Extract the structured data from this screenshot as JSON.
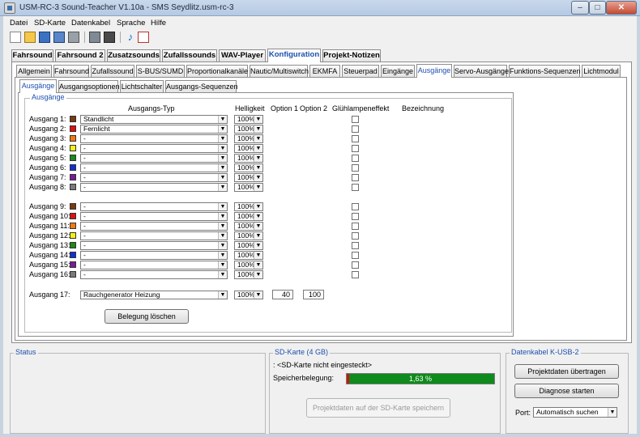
{
  "window": {
    "title": "USM-RC-3 Sound-Teacher V1.10a - SMS Seydlitz.usm-rc-3",
    "min": "–",
    "max": "□",
    "close": "✕"
  },
  "menu": [
    "Datei",
    "SD-Karte",
    "Datenkabel",
    "Sprache",
    "Hilfe"
  ],
  "main_tabs": [
    "Fahrsound",
    "Fahrsound 2",
    "Zusatzsounds",
    "Zufallssounds",
    "WAV-Player",
    "Konfiguration",
    "Projekt-Notizen"
  ],
  "main_tab_active": "Konfiguration",
  "config_tabs": [
    "Allgemein",
    "Fahrsound",
    "Zufallssound",
    "S-BUS/SUMD",
    "Proportionalkanäle",
    "Nautic/Multiswitch",
    "EKMFA",
    "Steuerpad",
    "Eingänge",
    "Ausgänge",
    "Servo-Ausgänge",
    "Funktions-Sequenzen",
    "Lichtmodul"
  ],
  "config_tab_active": "Ausgänge",
  "sub_tabs": [
    "Ausgänge",
    "Ausgangsoptionen",
    "Lichtschalter",
    "Ausgangs-Sequenzen"
  ],
  "sub_tab_active": "Ausgänge",
  "group_title": "Ausgänge",
  "headers": {
    "type": "Ausgangs-Typ",
    "brightness": "Helligkeit",
    "option1": "Option 1",
    "option2": "Option 2",
    "glow": "Glühlampeneffekt",
    "name": "Bezeichnung"
  },
  "outputs": [
    {
      "label": "Ausgang 1:",
      "color": "#7a3a10",
      "type": "Standlicht",
      "brightness": "100%"
    },
    {
      "label": "Ausgang 2:",
      "color": "#e01010",
      "type": "Fernlicht",
      "brightness": "100%"
    },
    {
      "label": "Ausgang 3:",
      "color": "#f07a10",
      "type": "-",
      "brightness": "100%"
    },
    {
      "label": "Ausgang 4:",
      "color": "#f4f010",
      "type": "-",
      "brightness": "100%"
    },
    {
      "label": "Ausgang 5:",
      "color": "#1a8a1a",
      "type": "-",
      "brightness": "100%"
    },
    {
      "label": "Ausgang 6:",
      "color": "#1030d0",
      "type": "-",
      "brightness": "100%"
    },
    {
      "label": "Ausgang 7:",
      "color": "#7a1a9a",
      "type": "-",
      "brightness": "100%"
    },
    {
      "label": "Ausgang 8:",
      "color": "#7a7a7a",
      "type": "-",
      "brightness": "100%"
    },
    {
      "label": "Ausgang 9:",
      "color": "#7a3a10",
      "type": "-",
      "brightness": "100%"
    },
    {
      "label": "Ausgang 10:",
      "color": "#e01010",
      "type": "-",
      "brightness": "100%"
    },
    {
      "label": "Ausgang 11:",
      "color": "#f07a10",
      "type": "-",
      "brightness": "100%"
    },
    {
      "label": "Ausgang 12:",
      "color": "#f4f010",
      "type": "-",
      "brightness": "100%"
    },
    {
      "label": "Ausgang 13:",
      "color": "#1a8a1a",
      "type": "-",
      "brightness": "100%"
    },
    {
      "label": "Ausgang 14:",
      "color": "#1030d0",
      "type": "-",
      "brightness": "100%"
    },
    {
      "label": "Ausgang 15:",
      "color": "#7a1a9a",
      "type": "-",
      "brightness": "100%"
    },
    {
      "label": "Ausgang 16:",
      "color": "#7a7a7a",
      "type": "-",
      "brightness": "100%"
    }
  ],
  "output17": {
    "label": "Ausgang 17:",
    "type": "Rauchgenerator Heizung",
    "brightness": "100%",
    "option1": "40",
    "option2": "100"
  },
  "clear_button": "Belegung löschen",
  "status": {
    "title": "Status"
  },
  "sdcard": {
    "title": "SD-Karte (4 GB)",
    "message": ": <SD-Karte nicht eingesteckt>",
    "usage_label": "Speicherbelegung:",
    "usage_text": "1,63 %",
    "usage_fraction": 0.0163,
    "save_button": "Projektdaten auf der SD-Karte speichern"
  },
  "cable": {
    "title": "Datenkabel K-USB-2",
    "transfer_button": "Projektdaten übertragen",
    "diagnose_button": "Diagnose starten",
    "port_label": "Port:",
    "port_value": "Automatisch suchen"
  },
  "colors": {
    "accent": "#1d4fae",
    "progress_green": "#0f8a1c",
    "progress_red": "#c9140e"
  }
}
